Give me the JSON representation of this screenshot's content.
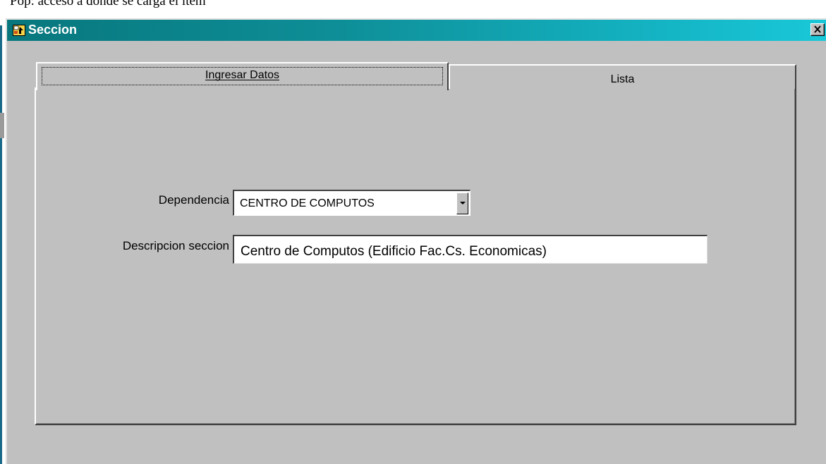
{
  "document": {
    "caption": "Pop: acceso a donde se carga el item"
  },
  "window": {
    "title": "Seccion",
    "title_icon": "form-icon",
    "close_glyph": "✕"
  },
  "tabs": [
    {
      "label": "Ingresar Datos",
      "active": true
    },
    {
      "label": "Lista",
      "active": false
    }
  ],
  "form": {
    "dependencia_label": "Dependencia",
    "dependencia_value": "CENTRO DE COMPUTOS",
    "descripcion_label": "Descripcion seccion",
    "descripcion_value": "Centro de Computos (Edificio Fac.Cs. Economicas)"
  },
  "colors": {
    "titlebar_start": "#08777d",
    "titlebar_end": "#19c8d8",
    "face": "#c0c0c0"
  }
}
